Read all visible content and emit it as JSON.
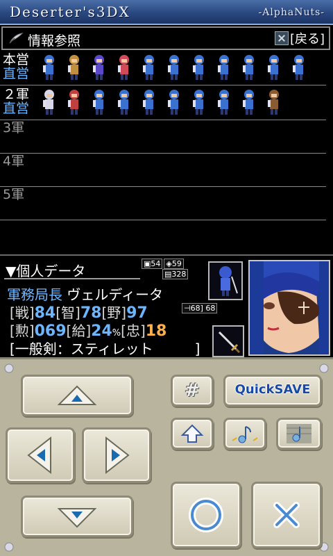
{
  "titlebar": {
    "left": "Deserter's3DX",
    "right": "-AlphaNuts-"
  },
  "info_header": {
    "title": "情報参照",
    "back_label": "[戻る]"
  },
  "armies": [
    {
      "label": "本営",
      "sub": "直営",
      "unit_count": 11
    },
    {
      "label": "２軍",
      "sub": "直営",
      "unit_count": 10
    },
    {
      "label": "3軍",
      "sub": "",
      "unit_count": 0
    },
    {
      "label": "4軍",
      "sub": "",
      "unit_count": 0
    },
    {
      "label": "5軍",
      "sub": "",
      "unit_count": 0
    }
  ],
  "personal": {
    "header": "▼個人データ",
    "mini_stats": {
      "a": "54",
      "b": "59",
      "c": "328"
    },
    "title": "軍務局長",
    "name": "ヴェルディータ",
    "stats1": [
      {
        "label": "[戦]",
        "value": "84"
      },
      {
        "label": "[智]",
        "value": "78"
      },
      {
        "label": "[野]",
        "value": "97"
      }
    ],
    "hit": {
      "a": "68",
      "b": "68"
    },
    "stats2": [
      {
        "label": "[勲]",
        "value": "069"
      },
      {
        "label": "[給]",
        "value": "24",
        "unit": "%"
      },
      {
        "label": "[忠]",
        "value": "18"
      }
    ],
    "weapon": "[一般剣：スティレット　　　]"
  },
  "controls": {
    "quicksave_label": "QuickSAVE",
    "sharp_label": "#"
  },
  "colors": {
    "accent_blue": "#6cb6ff",
    "orange": "#ffb04a",
    "pad_bg": "#b9b49e",
    "title_bg": "#2a4880"
  }
}
